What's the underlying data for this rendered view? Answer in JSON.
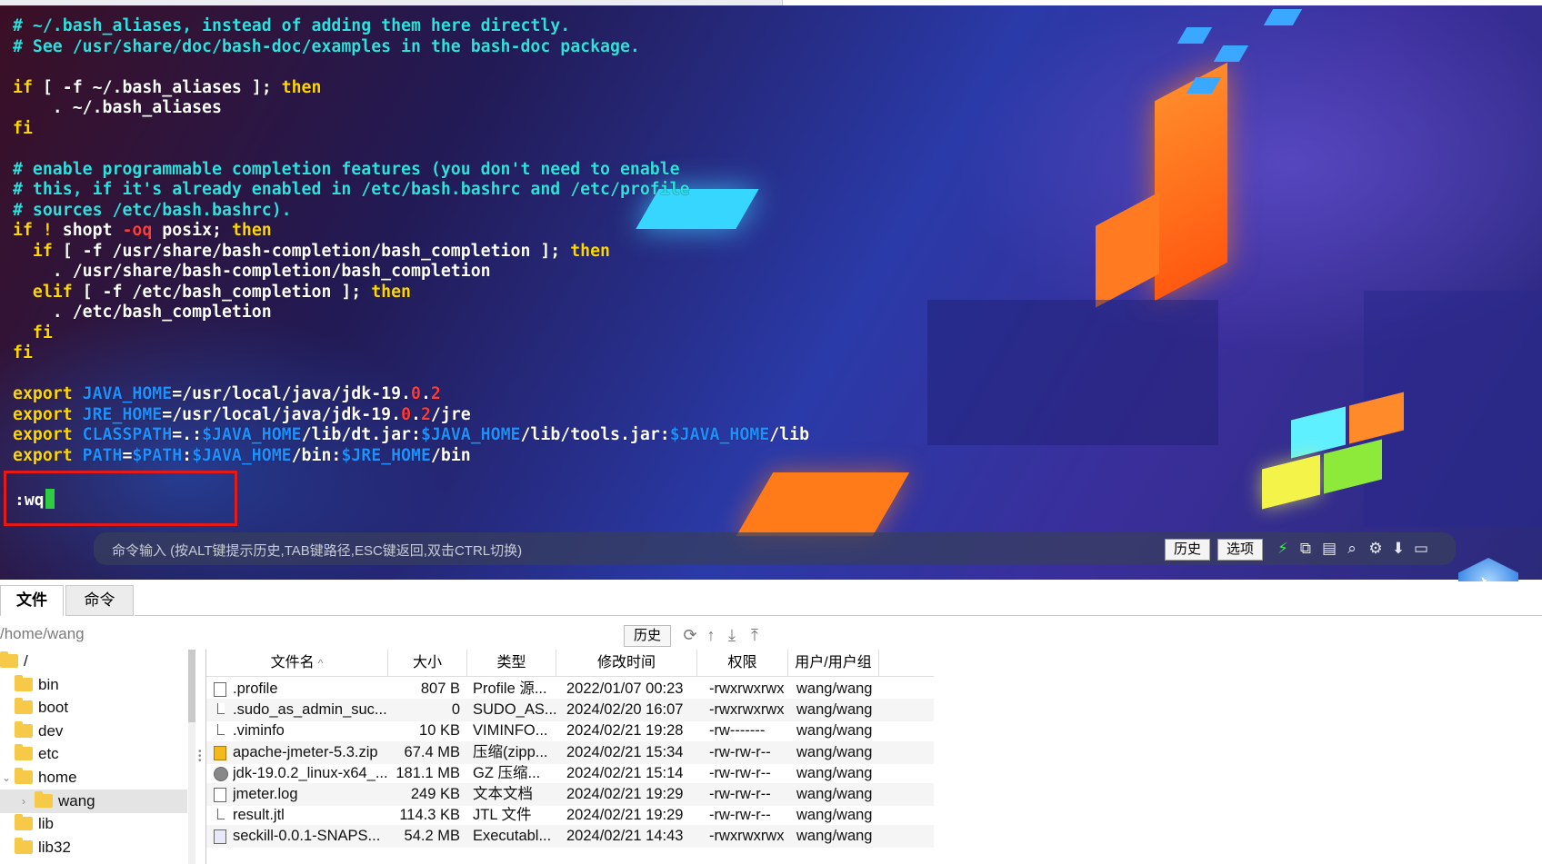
{
  "terminal": {
    "lines": [
      [
        {
          "t": "# ~/.bash_aliases, instead of adding them here directly.",
          "c": "cm"
        }
      ],
      [
        {
          "t": "# See /usr/share/doc/bash-doc/examples in the bash-doc package.",
          "c": "cm"
        }
      ],
      [
        {
          "t": "",
          "c": ""
        }
      ],
      [
        {
          "t": "if",
          "c": "kw"
        },
        {
          "t": " [ -f ~/.bash_aliases ]; ",
          "c": ""
        },
        {
          "t": "then",
          "c": "kw"
        }
      ],
      [
        {
          "t": "    . ~/.bash_aliases",
          "c": ""
        }
      ],
      [
        {
          "t": "fi",
          "c": "kw"
        }
      ],
      [
        {
          "t": "",
          "c": ""
        }
      ],
      [
        {
          "t": "# enable programmable completion features (you don't need to enable",
          "c": "cm"
        }
      ],
      [
        {
          "t": "# this, if it's already enabled in /etc/bash.bashrc and /etc/profile",
          "c": "cm"
        }
      ],
      [
        {
          "t": "# sources /etc/bash.bashrc).",
          "c": "cm"
        }
      ],
      [
        {
          "t": "if",
          "c": "kw"
        },
        {
          "t": " ! ",
          "c": "kw"
        },
        {
          "t": "shopt ",
          "c": ""
        },
        {
          "t": "-oq",
          "c": "n"
        },
        {
          "t": " posix; ",
          "c": ""
        },
        {
          "t": "then",
          "c": "kw"
        }
      ],
      [
        {
          "t": "  if",
          "c": "kw"
        },
        {
          "t": " [ -f /usr/share/bash-completion/bash_completion ]; ",
          "c": ""
        },
        {
          "t": "then",
          "c": "kw"
        }
      ],
      [
        {
          "t": "    . /usr/share/bash-completion/bash_completion",
          "c": ""
        }
      ],
      [
        {
          "t": "  elif",
          "c": "kw"
        },
        {
          "t": " [ -f /etc/bash_completion ]; ",
          "c": ""
        },
        {
          "t": "then",
          "c": "kw"
        }
      ],
      [
        {
          "t": "    . /etc/bash_completion",
          "c": ""
        }
      ],
      [
        {
          "t": "  fi",
          "c": "kw"
        }
      ],
      [
        {
          "t": "fi",
          "c": "kw"
        }
      ],
      [
        {
          "t": "",
          "c": ""
        }
      ],
      [
        {
          "t": "export",
          "c": "kw"
        },
        {
          "t": " JAVA_HOME",
          "c": "v"
        },
        {
          "t": "=/usr/local/java/jdk-19.",
          "c": ""
        },
        {
          "t": "0",
          "c": "n"
        },
        {
          "t": ".",
          "c": ""
        },
        {
          "t": "2",
          "c": "n"
        }
      ],
      [
        {
          "t": "export",
          "c": "kw"
        },
        {
          "t": " JRE_HOME",
          "c": "v"
        },
        {
          "t": "=/usr/local/java/jdk-19.",
          "c": ""
        },
        {
          "t": "0",
          "c": "n"
        },
        {
          "t": ".",
          "c": ""
        },
        {
          "t": "2",
          "c": "n"
        },
        {
          "t": "/jre",
          "c": ""
        }
      ],
      [
        {
          "t": "export",
          "c": "kw"
        },
        {
          "t": " CLASSPATH",
          "c": "v"
        },
        {
          "t": "=.:",
          "c": ""
        },
        {
          "t": "$JAVA_HOME",
          "c": "v"
        },
        {
          "t": "/lib/dt.jar:",
          "c": ""
        },
        {
          "t": "$JAVA_HOME",
          "c": "v"
        },
        {
          "t": "/lib/tools.jar:",
          "c": ""
        },
        {
          "t": "$JAVA_HOME",
          "c": "v"
        },
        {
          "t": "/lib",
          "c": ""
        }
      ],
      [
        {
          "t": "export",
          "c": "kw"
        },
        {
          "t": " PATH",
          "c": "v"
        },
        {
          "t": "=",
          "c": ""
        },
        {
          "t": "$PATH",
          "c": "v"
        },
        {
          "t": ":",
          "c": ""
        },
        {
          "t": "$JAVA_HOME",
          "c": "v"
        },
        {
          "t": "/bin:",
          "c": ""
        },
        {
          "t": "$JRE_HOME",
          "c": "v"
        },
        {
          "t": "/bin",
          "c": ""
        }
      ]
    ],
    "vim_command": ":wq",
    "colors": {
      "comment": "#2fe0e0",
      "keyword": "#ffd700",
      "variable": "#1e90ff",
      "number": "#ff3b3b",
      "highlight_box": "#e61919",
      "cursor": "#2ecc40"
    }
  },
  "cmdbar": {
    "placeholder": "命令输入 (按ALT键提示历史,TAB键路径,ESC键返回,双击CTRL切换)",
    "history_label": "历史",
    "options_label": "选项",
    "icons": [
      "lightning-icon",
      "copy-icon",
      "paste-icon",
      "search-icon",
      "gear-icon",
      "arrow-down-icon",
      "window-icon"
    ]
  },
  "tabs": [
    {
      "label": "文件"
    },
    {
      "label": "命令"
    }
  ],
  "pathbar": {
    "path": "/home/wang",
    "history_label": "历史"
  },
  "tree": {
    "items": [
      {
        "label": "/",
        "level": 0,
        "expanded": true
      },
      {
        "label": "bin",
        "level": 1
      },
      {
        "label": "boot",
        "level": 1
      },
      {
        "label": "dev",
        "level": 1
      },
      {
        "label": "etc",
        "level": 1
      },
      {
        "label": "home",
        "level": 1,
        "expanded": true
      },
      {
        "label": "wang",
        "level": 2,
        "selected": true,
        "collapsed": true
      },
      {
        "label": "lib",
        "level": 1
      },
      {
        "label": "lib32",
        "level": 1
      }
    ]
  },
  "table": {
    "columns": [
      "文件名",
      "大小",
      "类型",
      "修改时间",
      "权限",
      "用户/用户组"
    ],
    "sort_indicator": "^",
    "rows": [
      {
        "name": ".profile",
        "size": "807 B",
        "type": "Profile 源...",
        "mtime": "2022/01/07 00:23",
        "perm": "-rwxrwxrwx",
        "owner": "wang/wang",
        "icon": "doc-icon"
      },
      {
        "name": ".sudo_as_admin_suc...",
        "size": "0",
        "type": "SUDO_AS...",
        "mtime": "2024/02/20 16:07",
        "perm": "-rwxrwxrwx",
        "owner": "wang/wang",
        "icon": "blank-file-icon"
      },
      {
        "name": ".viminfo",
        "size": "10 KB",
        "type": "VIMINFO...",
        "mtime": "2024/02/21 19:28",
        "perm": "-rw-------",
        "owner": "wang/wang",
        "icon": "blank-file-icon"
      },
      {
        "name": "apache-jmeter-5.3.zip",
        "size": "67.4 MB",
        "type": "压缩(zipp...",
        "mtime": "2024/02/21 15:34",
        "perm": "-rw-rw-r--",
        "owner": "wang/wang",
        "icon": "zip-icon"
      },
      {
        "name": "jdk-19.0.2_linux-x64_...",
        "size": "181.1 MB",
        "type": "GZ 压缩...",
        "mtime": "2024/02/21 15:14",
        "perm": "-rw-rw-r--",
        "owner": "wang/wang",
        "icon": "gz-icon"
      },
      {
        "name": "jmeter.log",
        "size": "249 KB",
        "type": "文本文档",
        "mtime": "2024/02/21 19:29",
        "perm": "-rw-rw-r--",
        "owner": "wang/wang",
        "icon": "text-file-icon"
      },
      {
        "name": "result.jtl",
        "size": "114.3 KB",
        "type": "JTL 文件",
        "mtime": "2024/02/21 19:29",
        "perm": "-rw-rw-r--",
        "owner": "wang/wang",
        "icon": "blank-file-icon"
      },
      {
        "name": "seckill-0.0.1-SNAPS...",
        "size": "54.2 MB",
        "type": "Executabl...",
        "mtime": "2024/02/21 14:43",
        "perm": "-rwxrwxrwx",
        "owner": "wang/wang",
        "icon": "jar-icon"
      }
    ]
  }
}
